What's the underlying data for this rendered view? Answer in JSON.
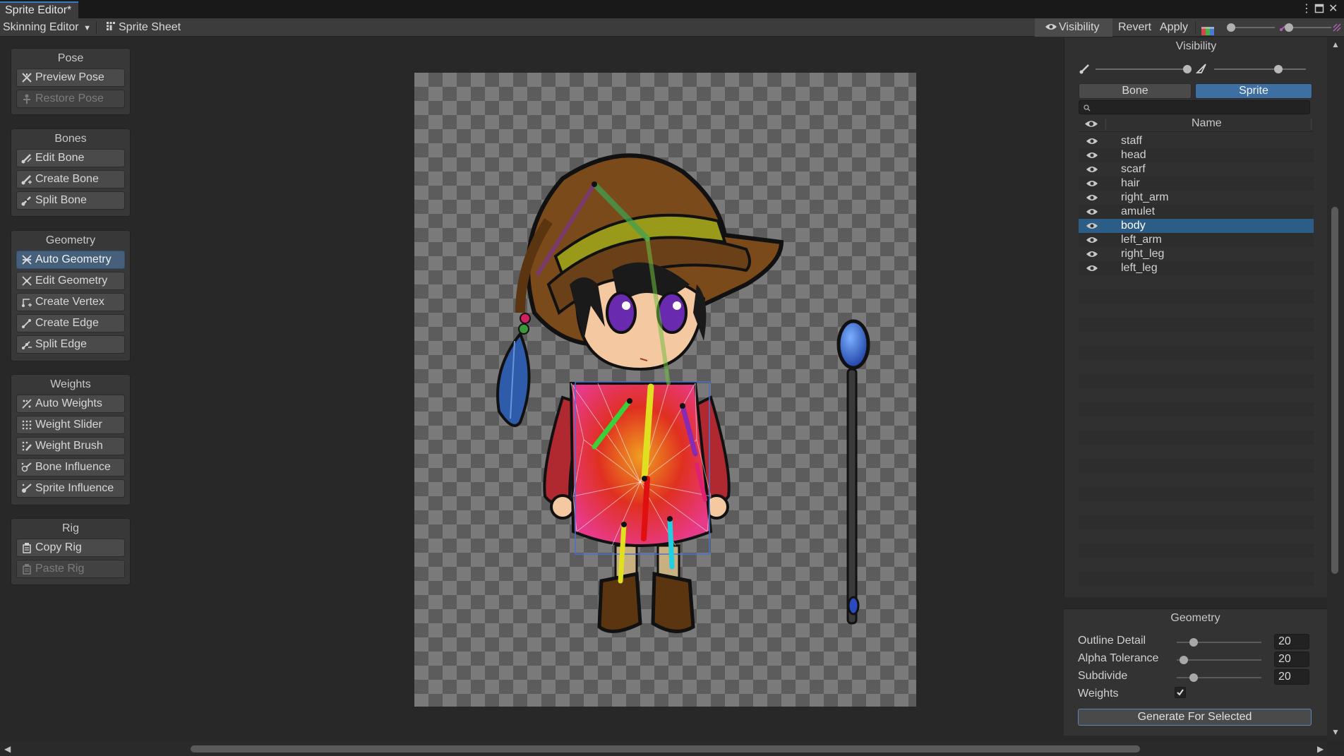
{
  "window": {
    "title": "Sprite Editor*",
    "menu_icon": "kebab-icon",
    "maximize_icon": "maximize-icon",
    "close_icon": "close-icon"
  },
  "toolbar": {
    "mode_dropdown": "Skinning Editor",
    "sprite_sheet": "Sprite Sheet",
    "visibility": "Visibility",
    "revert": "Revert",
    "apply": "Apply"
  },
  "left_panel": {
    "pose": {
      "title": "Pose",
      "tools": [
        "Preview Pose",
        "Restore Pose"
      ]
    },
    "bones": {
      "title": "Bones",
      "tools": [
        "Edit Bone",
        "Create Bone",
        "Split Bone"
      ]
    },
    "geometry": {
      "title": "Geometry",
      "tools": [
        "Auto Geometry",
        "Edit Geometry",
        "Create Vertex",
        "Create Edge",
        "Split Edge"
      ]
    },
    "weights": {
      "title": "Weights",
      "tools": [
        "Auto Weights",
        "Weight Slider",
        "Weight Brush",
        "Bone Influence",
        "Sprite Influence"
      ]
    },
    "rig": {
      "title": "Rig",
      "tools": [
        "Copy Rig",
        "Paste Rig"
      ]
    }
  },
  "visibility_panel": {
    "title": "Visibility",
    "tabs": [
      "Bone",
      "Sprite"
    ],
    "active_tab": "Sprite",
    "search_placeholder": "",
    "column_name": "Name",
    "sprites": [
      "staff",
      "head",
      "scarf",
      "hair",
      "right_arm",
      "amulet",
      "body",
      "left_arm",
      "right_leg",
      "left_leg"
    ],
    "selected": "body",
    "bone_opacity": 1.0,
    "mesh_opacity": 0.7
  },
  "geometry_panel": {
    "title": "Geometry",
    "outline_detail": {
      "label": "Outline Detail",
      "value": "20",
      "fraction": 0.2
    },
    "alpha_tolerance": {
      "label": "Alpha Tolerance",
      "value": "20",
      "fraction": 0.08
    },
    "subdivide": {
      "label": "Subdivide",
      "value": "20",
      "fraction": 0.2
    },
    "weights": {
      "label": "Weights",
      "checked": true
    },
    "generate": "Generate For Selected"
  },
  "colors": {
    "accent": "#46607c",
    "selection": "#2c5d87",
    "tab_active": "#3d6fa3"
  }
}
